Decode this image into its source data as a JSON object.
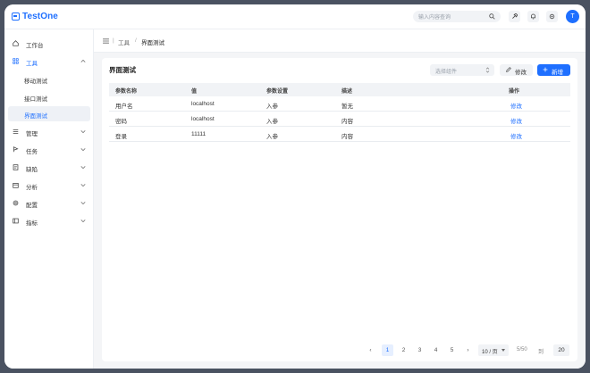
{
  "app": {
    "name": "TestOne"
  },
  "header": {
    "search_placeholder": "输入内容查询",
    "avatar_initial": "T"
  },
  "sidebar": {
    "items": [
      {
        "label": "工作台",
        "icon": "home-icon"
      },
      {
        "label": "工具",
        "icon": "grid-icon"
      },
      {
        "label": "移动测试"
      },
      {
        "label": "接口测试"
      },
      {
        "label": "界面测试"
      },
      {
        "label": "管理",
        "icon": "list-icon"
      },
      {
        "label": "任务",
        "icon": "flag-icon"
      },
      {
        "label": "缺陷",
        "icon": "bug-doc-icon"
      },
      {
        "label": "分析",
        "icon": "calendar-icon"
      },
      {
        "label": "配置",
        "icon": "gear-icon"
      },
      {
        "label": "指标",
        "icon": "panel-icon"
      }
    ]
  },
  "breadcrumb": {
    "items": [
      "工具",
      "界面测试"
    ],
    "separator": "/"
  },
  "card": {
    "title": "界面测试",
    "select_placeholder": "选择组件",
    "edit_label": "修改",
    "add_label": "新增"
  },
  "table": {
    "columns": [
      "参数名称",
      "值",
      "参数设置",
      "描述",
      "操作"
    ],
    "rows": [
      [
        "用户名",
        "localhost",
        "入参",
        "暂无",
        "修改"
      ],
      [
        "密码",
        "localhost",
        "入参",
        "内容",
        "修改"
      ],
      [
        "登录",
        "11111",
        "入参",
        "内容",
        "修改"
      ]
    ]
  },
  "pagination": {
    "prev": "‹",
    "next": "›",
    "pages": [
      "1",
      "2",
      "3",
      "4",
      "5"
    ],
    "current": "1",
    "page_size": "10 / 页",
    "total": "5/50",
    "goto_label": "到",
    "goto_value": "20"
  },
  "colors": {
    "accent": "#1e6fff",
    "frame": "#4a5261",
    "surface": "#f4f5f7"
  }
}
